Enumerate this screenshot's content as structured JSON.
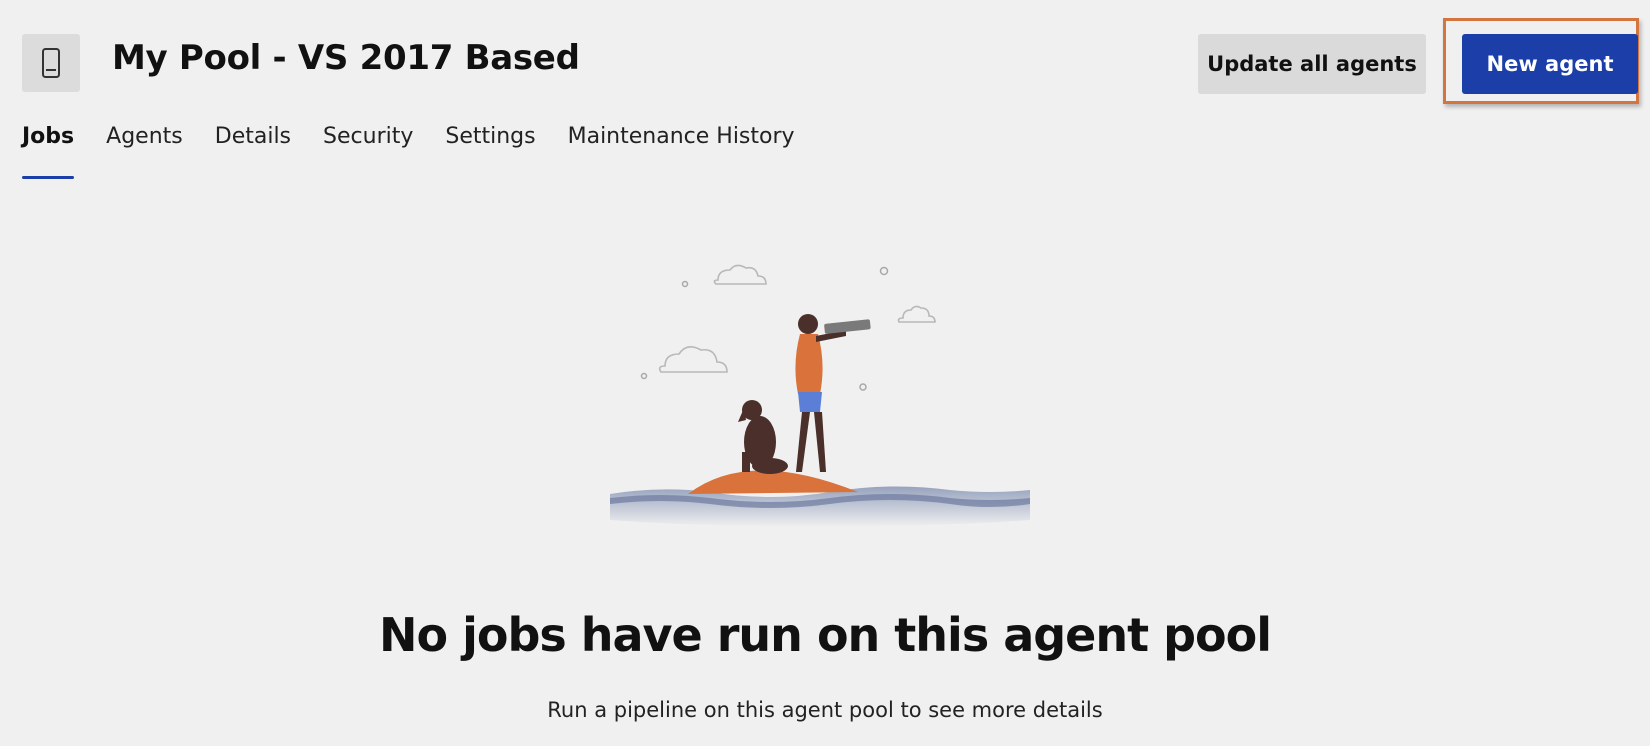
{
  "header": {
    "title": "My Pool - VS 2017 Based",
    "icon": "agent-pool-icon",
    "update_all_label": "Update all agents",
    "new_agent_label": "New agent"
  },
  "tabs": [
    {
      "label": "Jobs",
      "active": true
    },
    {
      "label": "Agents",
      "active": false
    },
    {
      "label": "Details",
      "active": false
    },
    {
      "label": "Security",
      "active": false
    },
    {
      "label": "Settings",
      "active": false
    },
    {
      "label": "Maintenance History",
      "active": false
    }
  ],
  "empty_state": {
    "illustration": "person-with-spyglass-on-island-illustration",
    "title": "No jobs have run on this agent pool",
    "subtitle": "Run a pipeline on this agent pool to see more details"
  },
  "colors": {
    "background": "#f0f0f0",
    "primary_button": "#1b3ea8",
    "secondary_button": "#dadada",
    "tab_underline": "#1b3ea8",
    "highlight_frame": "#d2753e",
    "island": "#d9733b"
  }
}
